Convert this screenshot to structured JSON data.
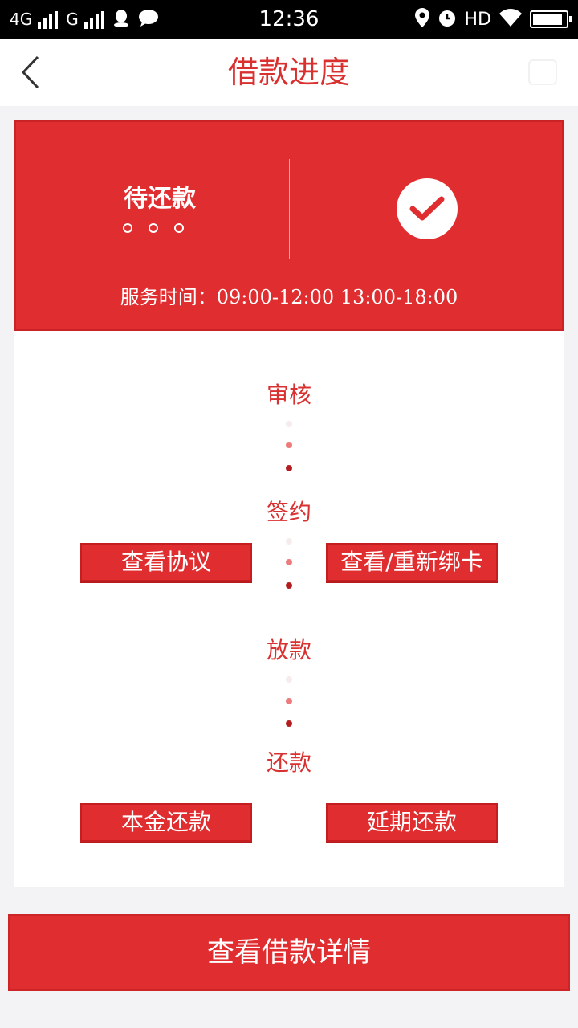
{
  "status_bar": {
    "net1": "4G",
    "net2": "G",
    "time": "12:36",
    "hd": "HD"
  },
  "header": {
    "title": "借款进度"
  },
  "status_card": {
    "status": "待还款",
    "service_time": "服务时间：09:00-12:00 13:00-18:00"
  },
  "steps": [
    {
      "label": "审核"
    },
    {
      "label": "签约"
    },
    {
      "label": "放款"
    },
    {
      "label": "还款"
    }
  ],
  "actions": {
    "view_agreement": "查看协议",
    "rebind_card": "查看/重新绑卡",
    "principal_repay": "本金还款",
    "extend_repay": "延期还款"
  },
  "footer": {
    "detail_button": "查看借款详情"
  },
  "colors": {
    "brand_red": "#e02d2f",
    "title_red": "#d93030"
  },
  "icons": [
    "back-arrow-icon",
    "check-circle-icon",
    "signal-icon",
    "qq-icon",
    "chat-icon",
    "location-icon",
    "alarm-icon",
    "wifi-icon",
    "battery-icon"
  ]
}
